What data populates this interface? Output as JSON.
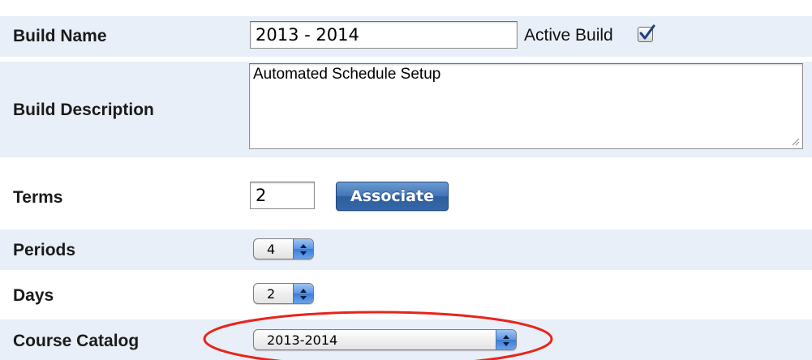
{
  "build_name": {
    "label": "Build Name",
    "value": "2013 - 2014",
    "active_label": "Active Build",
    "active_checked": true
  },
  "build_description": {
    "label": "Build Description",
    "value": "Automated Schedule Setup"
  },
  "terms": {
    "label": "Terms",
    "value": "2",
    "associate_label": "Associate"
  },
  "periods": {
    "label": "Periods",
    "selected": "4"
  },
  "days": {
    "label": "Days",
    "selected": "2"
  },
  "course_catalog": {
    "label": "Course Catalog",
    "selected": "2013-2014"
  },
  "colors": {
    "row_shade": "#e9eff8",
    "button_blue": "#3f74b8",
    "annotation_red": "#e8241a"
  },
  "icons": [
    "checkmark-icon",
    "select-arrows-icon",
    "resize-grip-icon"
  ]
}
